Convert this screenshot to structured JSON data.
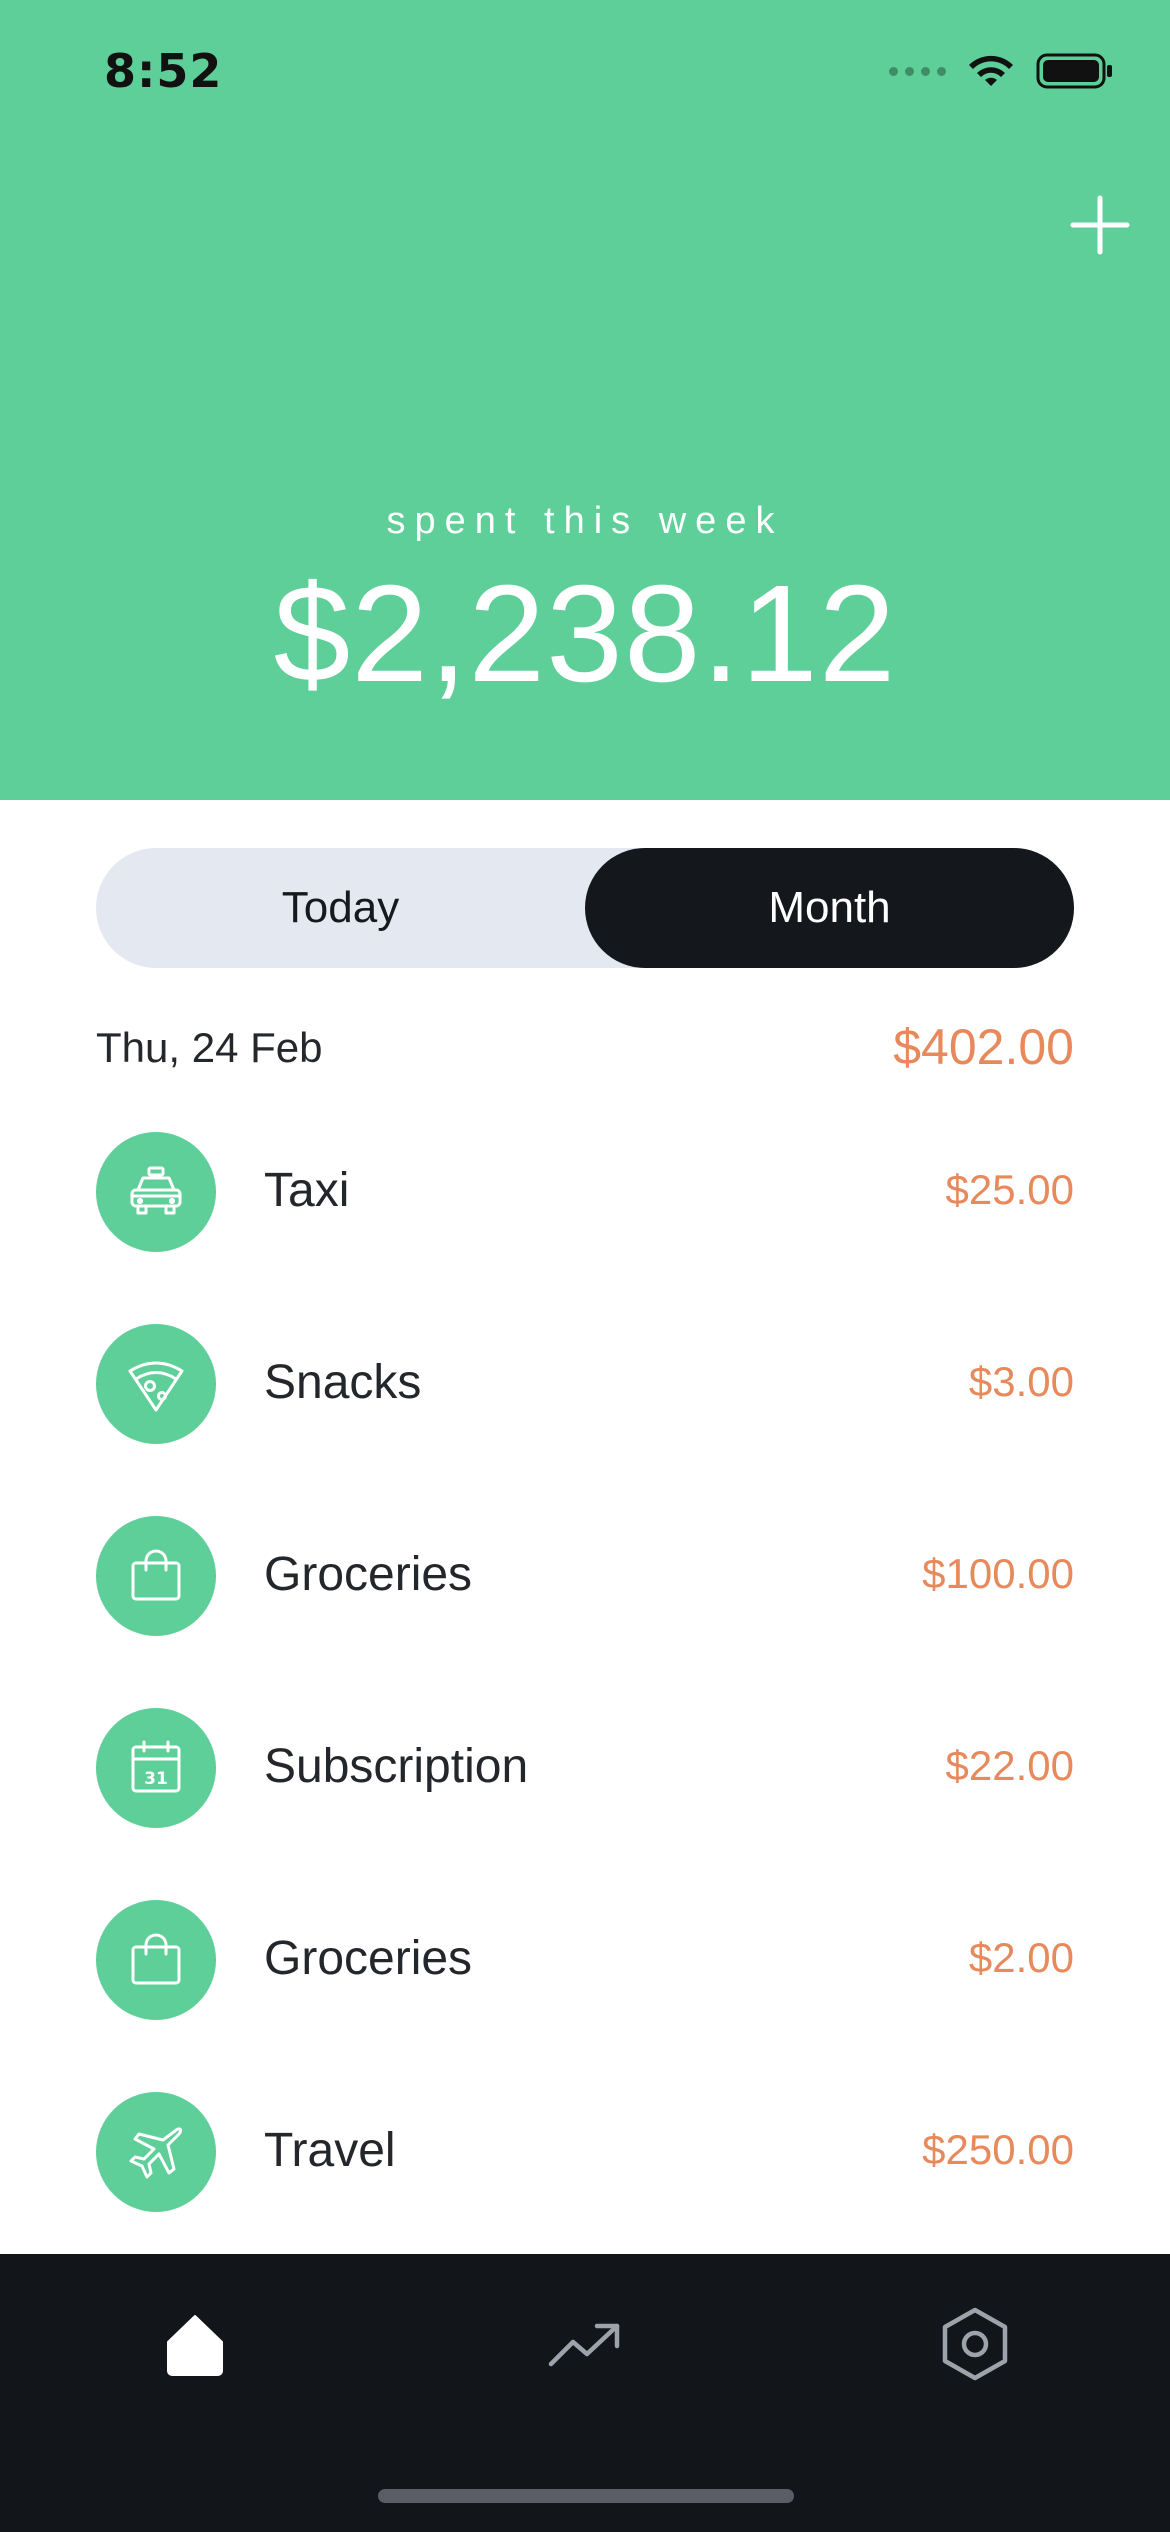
{
  "status_bar": {
    "time": "8:52"
  },
  "header": {
    "label": "spent this week",
    "amount": "$2,238.12",
    "add_icon": "plus-icon"
  },
  "segmented": {
    "options": [
      {
        "label": "Today",
        "selected": false
      },
      {
        "label": "Month",
        "selected": true
      }
    ]
  },
  "day": {
    "date": "Thu, 24 Feb",
    "total": "$402.00"
  },
  "transactions": [
    {
      "label": "Taxi",
      "amount": "$25.00",
      "icon": "taxi-icon"
    },
    {
      "label": "Snacks",
      "amount": "$3.00",
      "icon": "pizza-icon"
    },
    {
      "label": "Groceries",
      "amount": "$100.00",
      "icon": "shopping-bag-icon"
    },
    {
      "label": "Subscription",
      "amount": "$22.00",
      "icon": "calendar-icon",
      "icon_text": "31"
    },
    {
      "label": "Groceries",
      "amount": "$2.00",
      "icon": "shopping-bag-icon"
    },
    {
      "label": "Travel",
      "amount": "$250.00",
      "icon": "airplane-icon"
    }
  ],
  "tabbar": {
    "tabs": [
      {
        "name": "home",
        "icon": "home-icon",
        "active": true
      },
      {
        "name": "trends",
        "icon": "trending-up-icon",
        "active": false
      },
      {
        "name": "settings",
        "icon": "settings-hexagon-icon",
        "active": false
      }
    ]
  },
  "colors": {
    "accent_green": "#5ecf99",
    "amount_orange": "#e8895c",
    "dark": "#14171c",
    "segment_bg": "#e4e8f0"
  }
}
